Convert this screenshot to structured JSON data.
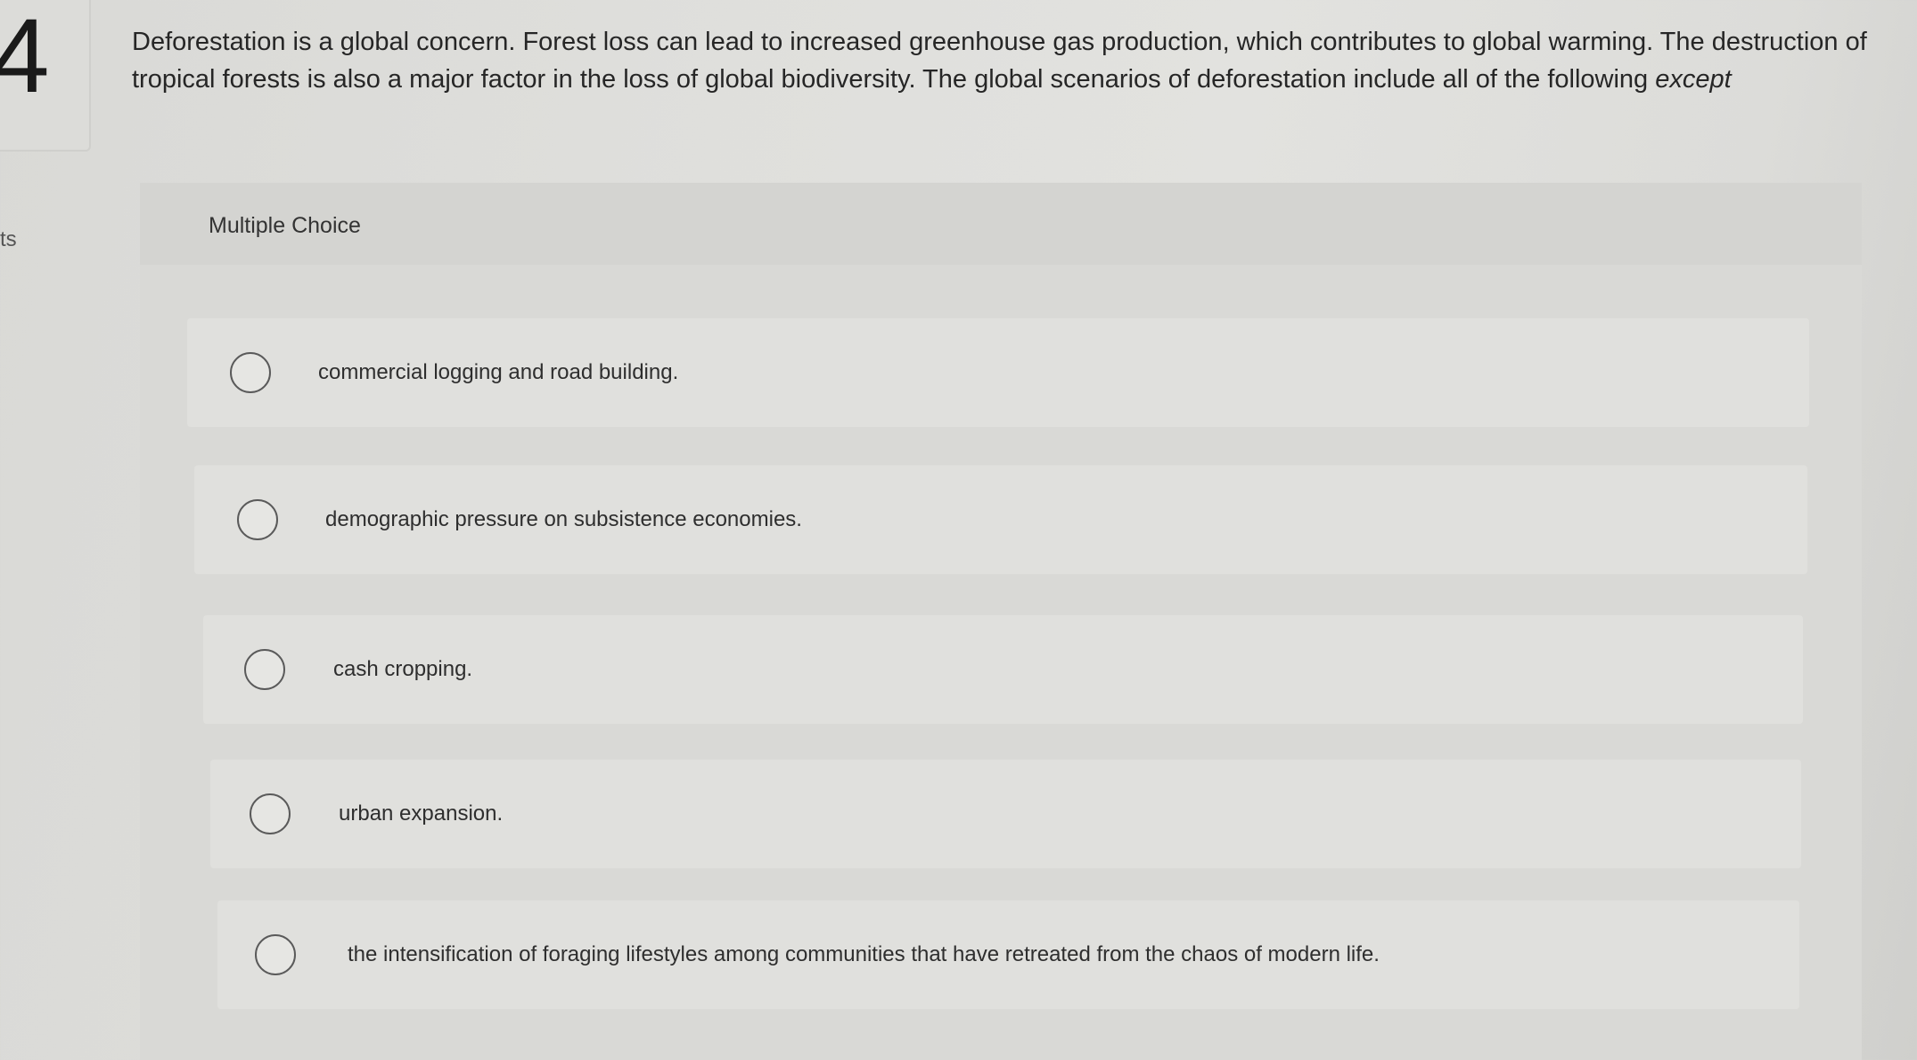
{
  "question": {
    "number": "4",
    "points_fragment": "ts",
    "text": "Deforestation is a global concern. Forest loss can lead to increased greenhouse gas production, which contributes to global warming. The destruction of tropical forests is also a major factor in the loss of global biodiversity. The global scenarios of deforestation include all of the following ",
    "emphasis": "except"
  },
  "panel": {
    "title": "Multiple Choice"
  },
  "options": [
    {
      "label": "commercial logging and road building."
    },
    {
      "label": "demographic pressure on subsistence economies."
    },
    {
      "label": "cash cropping."
    },
    {
      "label": "urban expansion."
    },
    {
      "label": "the intensification of foraging lifestyles among communities that have retreated from the chaos of modern life."
    }
  ]
}
